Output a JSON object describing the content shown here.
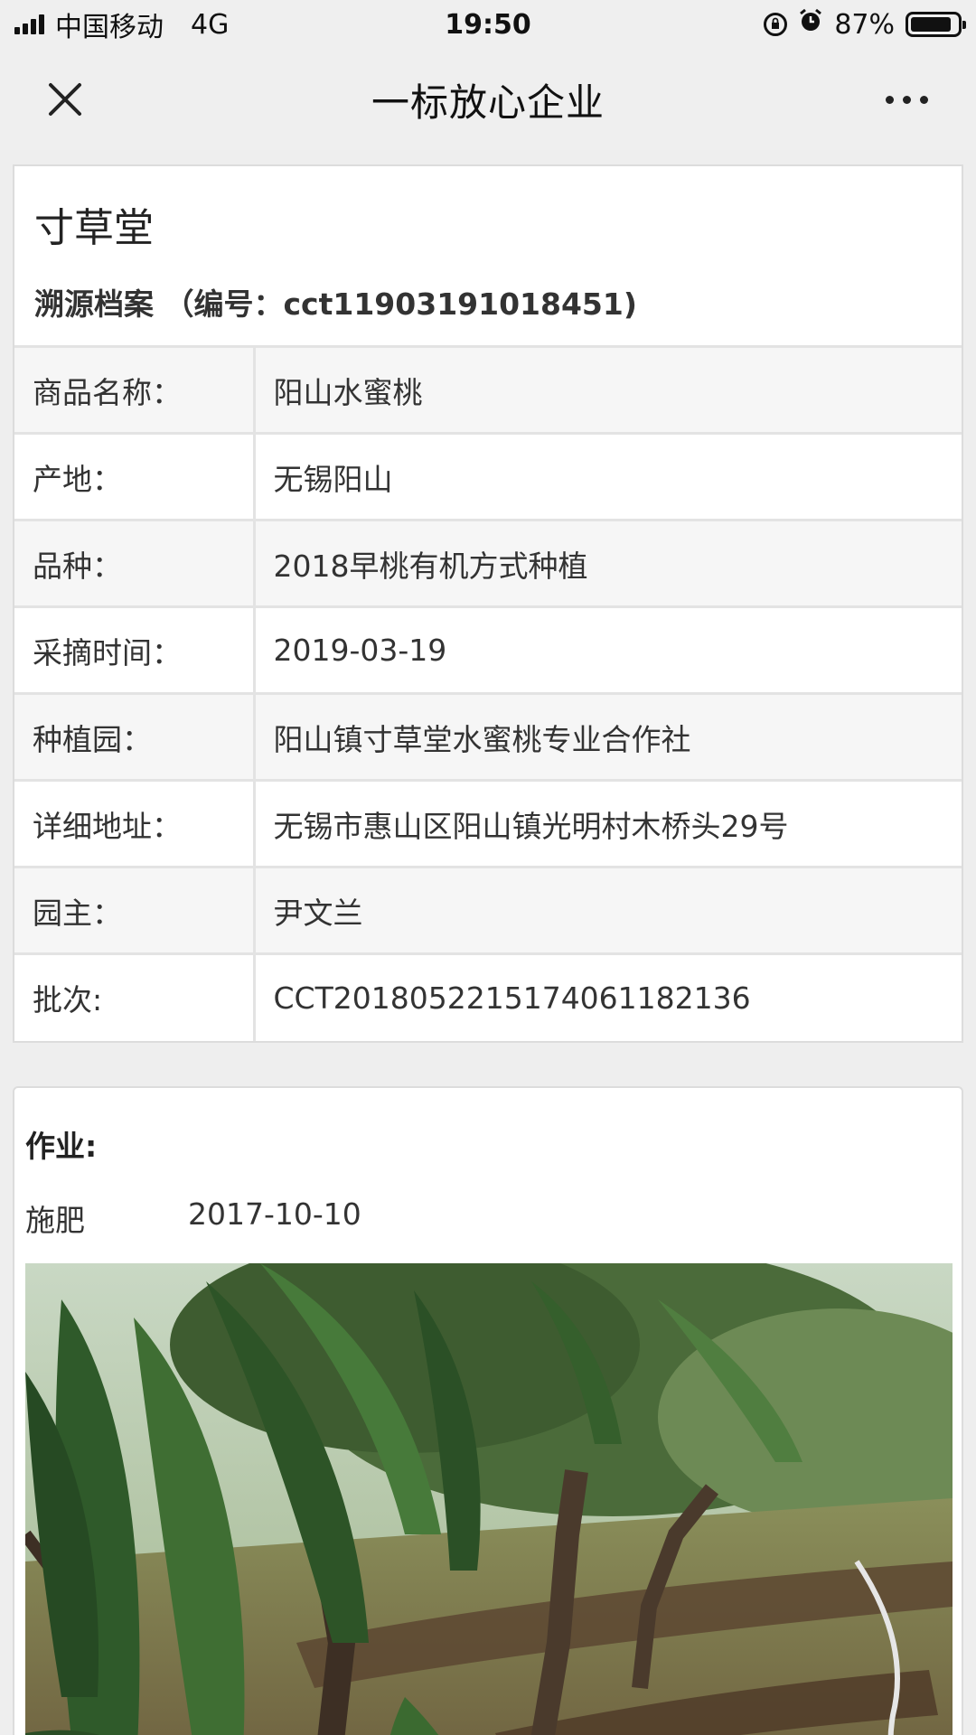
{
  "status_bar": {
    "carrier": "中国移动",
    "network": "4G",
    "time": "19:50",
    "battery_percent_label": "87%",
    "battery_level": 0.87,
    "icons": [
      "signal-icon",
      "rotation-lock-icon",
      "alarm-icon",
      "battery-icon"
    ]
  },
  "nav": {
    "title": "一标放心企业",
    "close_icon": "close-icon",
    "more_icon": "more-icon"
  },
  "archive": {
    "company_name": "寸草堂",
    "archive_line": "溯源档案 （编号：cct11903191018451)",
    "rows": [
      {
        "label": "商品名称：",
        "value": "阳山水蜜桃"
      },
      {
        "label": "产地：",
        "value": "无锡阳山"
      },
      {
        "label": "品种：",
        "value": "2018早桃有机方式种植"
      },
      {
        "label": "采摘时间：",
        "value": "2019-03-19"
      },
      {
        "label": "种植园：",
        "value": "阳山镇寸草堂水蜜桃专业合作社"
      },
      {
        "label": "详细地址：",
        "value": "无锡市惠山区阳山镇光明村木桥头29号"
      },
      {
        "label": "园主：",
        "value": "尹文兰"
      },
      {
        "label": "批次:",
        "value": "CCT2018052215174061182136"
      }
    ]
  },
  "operations": {
    "title": "作业:",
    "items": [
      {
        "name": "施肥",
        "date": "2017-10-10"
      }
    ]
  },
  "colors": {
    "bar_bg": "#efefef",
    "page_bg": "#eeeeee",
    "row_alt": "#f6f6f6",
    "border": "#e3e3e3"
  }
}
